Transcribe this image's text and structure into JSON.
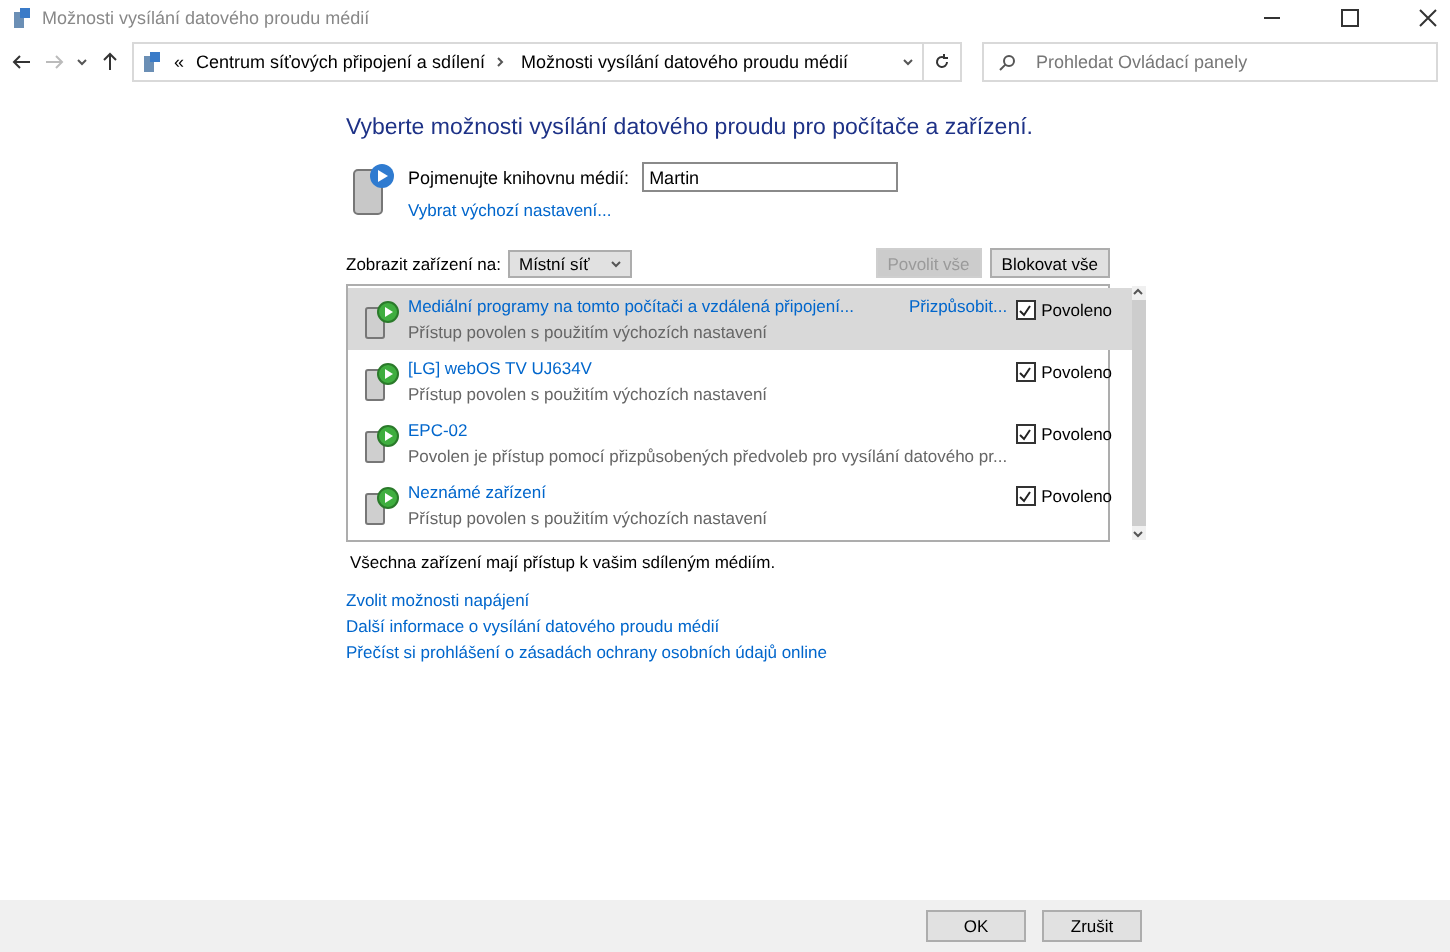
{
  "window": {
    "title": "Možnosti vysílání datového proudu médií"
  },
  "address": {
    "overflow": "«",
    "crumbs": [
      "Centrum síťových připojení a sdílení",
      "Možnosti vysílání datového proudu médií"
    ],
    "search_placeholder": "Prohledat Ovládací panely"
  },
  "heading": "Vyberte možnosti vysílání datového proudu pro počítače a zařízení.",
  "library": {
    "label": "Pojmenujte knihovnu médií:",
    "value": "Martin",
    "defaults_link": "Vybrat výchozí nastavení..."
  },
  "filter": {
    "label": "Zobrazit zařízení na:",
    "value": "Místní síť",
    "allow_all": {
      "label": "Povolit vše",
      "disabled": true
    },
    "block_all": {
      "label": "Blokovat vše",
      "disabled": false
    }
  },
  "devices": [
    {
      "name": "Mediální programy na tomto počítači a vzdálená připojení...",
      "status": "Přístup povolen s použitím výchozích nastavení",
      "customize": "Přizpůsobit...",
      "allowed_label": "Povoleno",
      "checked": true,
      "selected": true
    },
    {
      "name": "[LG] webOS TV UJ634V",
      "status": "Přístup povolen s použitím výchozích nastavení",
      "allowed_label": "Povoleno",
      "checked": true,
      "selected": false
    },
    {
      "name": "EPC-02",
      "status": "Povolen je přístup pomocí přizpůsobených předvoleb pro vysílání datového pr...",
      "allowed_label": "Povoleno",
      "checked": true,
      "selected": false
    },
    {
      "name": "Neznámé zařízení",
      "status": "Přístup povolen s použitím výchozích nastavení",
      "allowed_label": "Povoleno",
      "checked": true,
      "selected": false
    }
  ],
  "summary": "Všechna zařízení mají přístup k vašim sdíleným médiím.",
  "links": [
    "Zvolit možnosti napájení",
    "Další informace o vysílání datového proudu médií",
    "Přečíst si prohlášení o zásadách ochrany osobních údajů online"
  ],
  "buttons": [
    "OK",
    "Zrušit"
  ]
}
